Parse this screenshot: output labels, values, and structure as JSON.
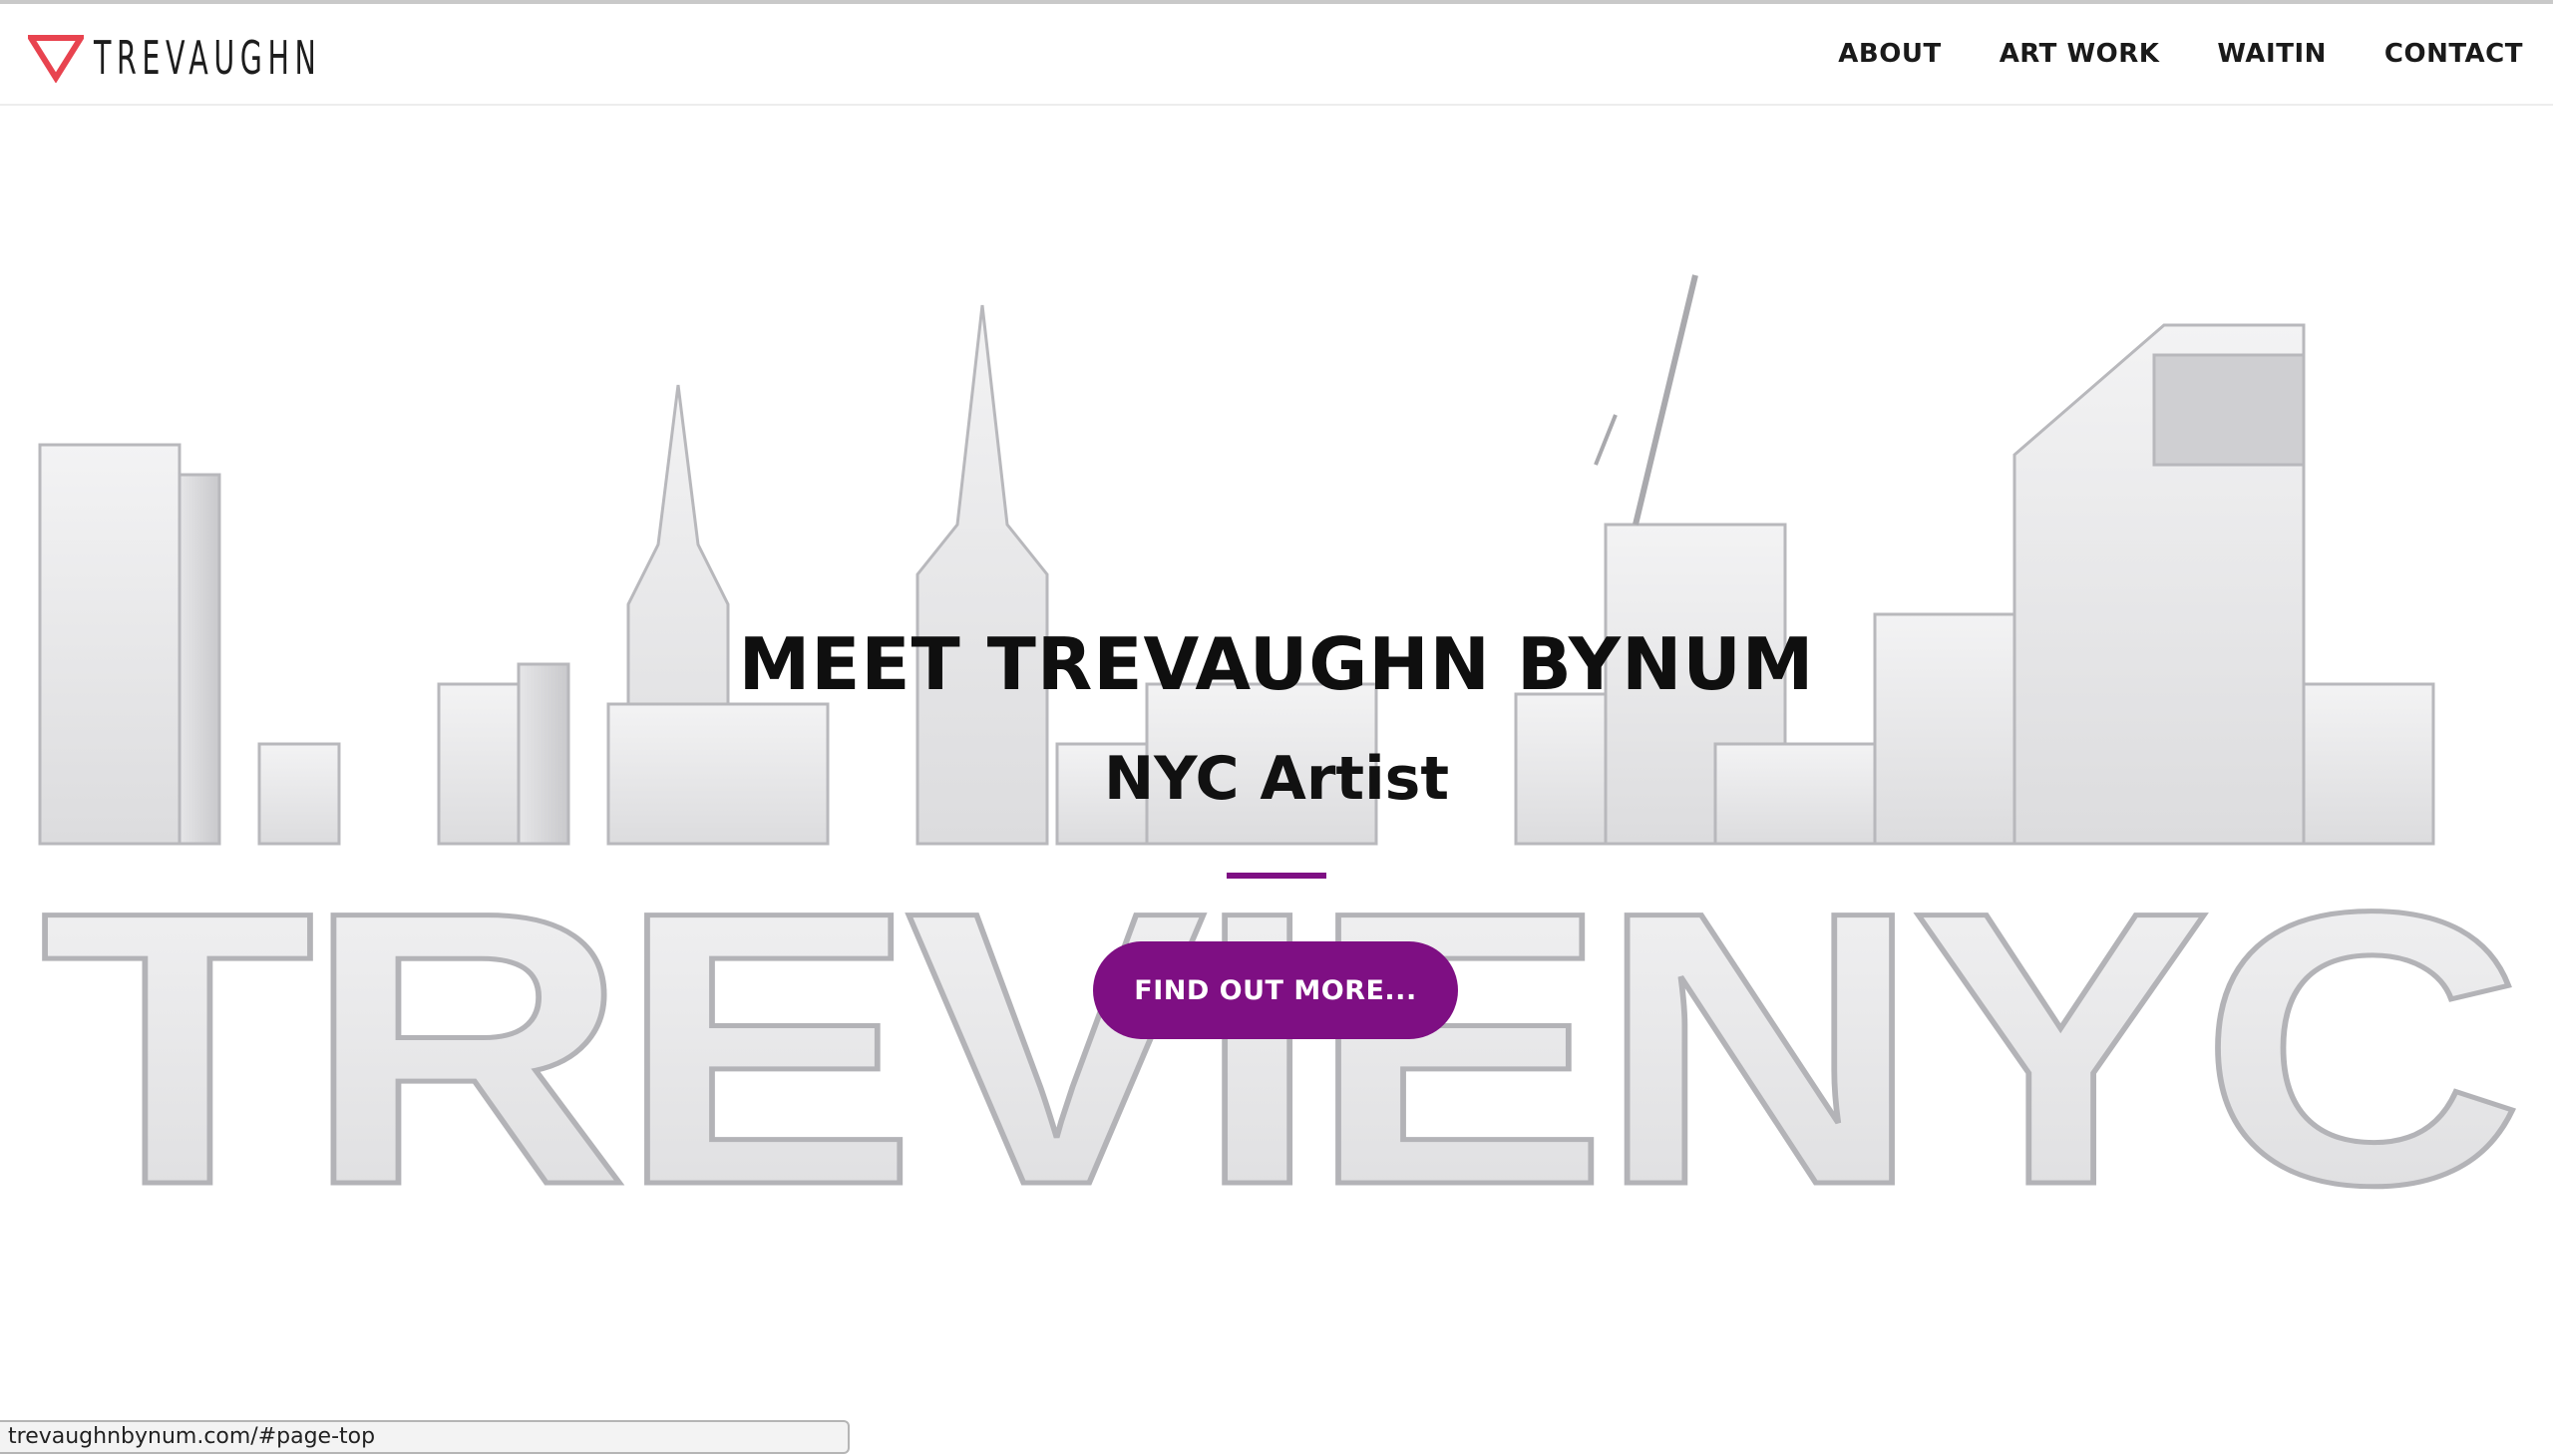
{
  "brand": {
    "name": "TREVAUGHN",
    "logo_icon": "triangle-logo-icon",
    "accent_color": "#e8434f"
  },
  "nav": {
    "items": [
      {
        "label": "ABOUT"
      },
      {
        "label": "ART WORK"
      },
      {
        "label": "WAITIN"
      },
      {
        "label": "CONTACT"
      }
    ]
  },
  "hero": {
    "title": "MEET TREVAUGHN BYNUM",
    "subtitle": "NYC Artist",
    "cta_label": "FIND OUT MORE...",
    "cta_color": "#7e0f83",
    "background_art_text": "TREVIENYC"
  },
  "status_bar": {
    "url": "trevaughnbynum.com/#page-top"
  }
}
